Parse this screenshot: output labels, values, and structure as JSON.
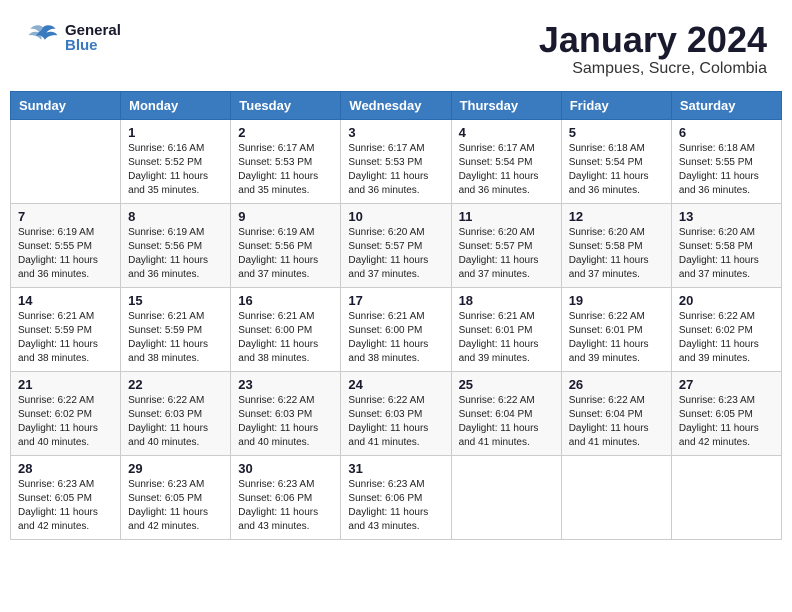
{
  "header": {
    "logo_general": "General",
    "logo_blue": "Blue",
    "month_title": "January 2024",
    "location": "Sampues, Sucre, Colombia"
  },
  "weekdays": [
    "Sunday",
    "Monday",
    "Tuesday",
    "Wednesday",
    "Thursday",
    "Friday",
    "Saturday"
  ],
  "weeks": [
    [
      {
        "day": "",
        "info": ""
      },
      {
        "day": "1",
        "info": "Sunrise: 6:16 AM\nSunset: 5:52 PM\nDaylight: 11 hours\nand 35 minutes."
      },
      {
        "day": "2",
        "info": "Sunrise: 6:17 AM\nSunset: 5:53 PM\nDaylight: 11 hours\nand 35 minutes."
      },
      {
        "day": "3",
        "info": "Sunrise: 6:17 AM\nSunset: 5:53 PM\nDaylight: 11 hours\nand 36 minutes."
      },
      {
        "day": "4",
        "info": "Sunrise: 6:17 AM\nSunset: 5:54 PM\nDaylight: 11 hours\nand 36 minutes."
      },
      {
        "day": "5",
        "info": "Sunrise: 6:18 AM\nSunset: 5:54 PM\nDaylight: 11 hours\nand 36 minutes."
      },
      {
        "day": "6",
        "info": "Sunrise: 6:18 AM\nSunset: 5:55 PM\nDaylight: 11 hours\nand 36 minutes."
      }
    ],
    [
      {
        "day": "7",
        "info": "Sunrise: 6:19 AM\nSunset: 5:55 PM\nDaylight: 11 hours\nand 36 minutes."
      },
      {
        "day": "8",
        "info": "Sunrise: 6:19 AM\nSunset: 5:56 PM\nDaylight: 11 hours\nand 36 minutes."
      },
      {
        "day": "9",
        "info": "Sunrise: 6:19 AM\nSunset: 5:56 PM\nDaylight: 11 hours\nand 37 minutes."
      },
      {
        "day": "10",
        "info": "Sunrise: 6:20 AM\nSunset: 5:57 PM\nDaylight: 11 hours\nand 37 minutes."
      },
      {
        "day": "11",
        "info": "Sunrise: 6:20 AM\nSunset: 5:57 PM\nDaylight: 11 hours\nand 37 minutes."
      },
      {
        "day": "12",
        "info": "Sunrise: 6:20 AM\nSunset: 5:58 PM\nDaylight: 11 hours\nand 37 minutes."
      },
      {
        "day": "13",
        "info": "Sunrise: 6:20 AM\nSunset: 5:58 PM\nDaylight: 11 hours\nand 37 minutes."
      }
    ],
    [
      {
        "day": "14",
        "info": "Sunrise: 6:21 AM\nSunset: 5:59 PM\nDaylight: 11 hours\nand 38 minutes."
      },
      {
        "day": "15",
        "info": "Sunrise: 6:21 AM\nSunset: 5:59 PM\nDaylight: 11 hours\nand 38 minutes."
      },
      {
        "day": "16",
        "info": "Sunrise: 6:21 AM\nSunset: 6:00 PM\nDaylight: 11 hours\nand 38 minutes."
      },
      {
        "day": "17",
        "info": "Sunrise: 6:21 AM\nSunset: 6:00 PM\nDaylight: 11 hours\nand 38 minutes."
      },
      {
        "day": "18",
        "info": "Sunrise: 6:21 AM\nSunset: 6:01 PM\nDaylight: 11 hours\nand 39 minutes."
      },
      {
        "day": "19",
        "info": "Sunrise: 6:22 AM\nSunset: 6:01 PM\nDaylight: 11 hours\nand 39 minutes."
      },
      {
        "day": "20",
        "info": "Sunrise: 6:22 AM\nSunset: 6:02 PM\nDaylight: 11 hours\nand 39 minutes."
      }
    ],
    [
      {
        "day": "21",
        "info": "Sunrise: 6:22 AM\nSunset: 6:02 PM\nDaylight: 11 hours\nand 40 minutes."
      },
      {
        "day": "22",
        "info": "Sunrise: 6:22 AM\nSunset: 6:03 PM\nDaylight: 11 hours\nand 40 minutes."
      },
      {
        "day": "23",
        "info": "Sunrise: 6:22 AM\nSunset: 6:03 PM\nDaylight: 11 hours\nand 40 minutes."
      },
      {
        "day": "24",
        "info": "Sunrise: 6:22 AM\nSunset: 6:03 PM\nDaylight: 11 hours\nand 41 minutes."
      },
      {
        "day": "25",
        "info": "Sunrise: 6:22 AM\nSunset: 6:04 PM\nDaylight: 11 hours\nand 41 minutes."
      },
      {
        "day": "26",
        "info": "Sunrise: 6:22 AM\nSunset: 6:04 PM\nDaylight: 11 hours\nand 41 minutes."
      },
      {
        "day": "27",
        "info": "Sunrise: 6:23 AM\nSunset: 6:05 PM\nDaylight: 11 hours\nand 42 minutes."
      }
    ],
    [
      {
        "day": "28",
        "info": "Sunrise: 6:23 AM\nSunset: 6:05 PM\nDaylight: 11 hours\nand 42 minutes."
      },
      {
        "day": "29",
        "info": "Sunrise: 6:23 AM\nSunset: 6:05 PM\nDaylight: 11 hours\nand 42 minutes."
      },
      {
        "day": "30",
        "info": "Sunrise: 6:23 AM\nSunset: 6:06 PM\nDaylight: 11 hours\nand 43 minutes."
      },
      {
        "day": "31",
        "info": "Sunrise: 6:23 AM\nSunset: 6:06 PM\nDaylight: 11 hours\nand 43 minutes."
      },
      {
        "day": "",
        "info": ""
      },
      {
        "day": "",
        "info": ""
      },
      {
        "day": "",
        "info": ""
      }
    ]
  ]
}
